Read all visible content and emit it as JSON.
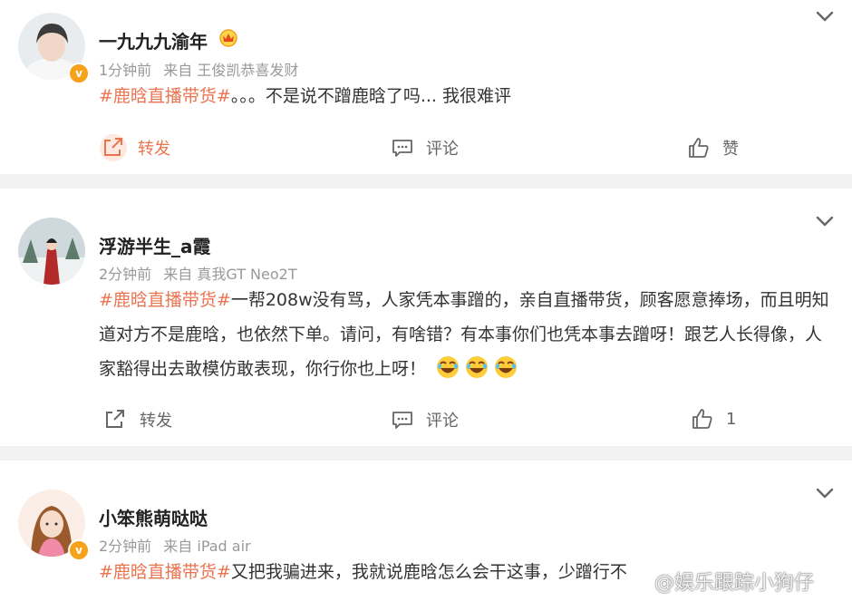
{
  "posts": [
    {
      "username": "一九九九渝年",
      "time": "1分钟前",
      "source": "来自 王俊凯恭喜发财",
      "tag": "#鹿晗直播带货#",
      "text": "。。。不是说不蹭鹿晗了吗... 我很难评",
      "actions": {
        "repost": "转发",
        "comment": "评论",
        "like": "赞"
      }
    },
    {
      "username": "浮游半生_a霞",
      "time": "2分钟前",
      "source": "来自 真我GT Neo2T",
      "tag": "#鹿晗直播带货#",
      "text": "一帮208w没有骂，人家凭本事蹭的，亲自直播带货，顾客愿意捧场，而且明知道对方不是鹿晗，也依然下单。请问，有啥错？有本事你们也凭本事去蹭呀！跟艺人长得像，人家豁得出去敢模仿敢表现，你行你也上呀！",
      "actions": {
        "repost": "转发",
        "comment": "评论",
        "like": "1"
      }
    },
    {
      "username": "小笨熊萌哒哒",
      "time": "2分钟前",
      "source": "来自 iPad air",
      "tag": "#鹿晗直播带货#",
      "text": "又把我骗进来，我就说鹿晗怎么会干这事，少蹭行不"
    }
  ],
  "watermark": "@娱乐跟踪小狗仔",
  "colors": {
    "accent": "#eb7350",
    "badge": "#f7a21b",
    "meta": "#999999"
  },
  "icons": [
    "repost-icon",
    "comment-icon",
    "like-icon",
    "chevron-down-icon",
    "crown-badge-icon",
    "laugh-emoji"
  ]
}
